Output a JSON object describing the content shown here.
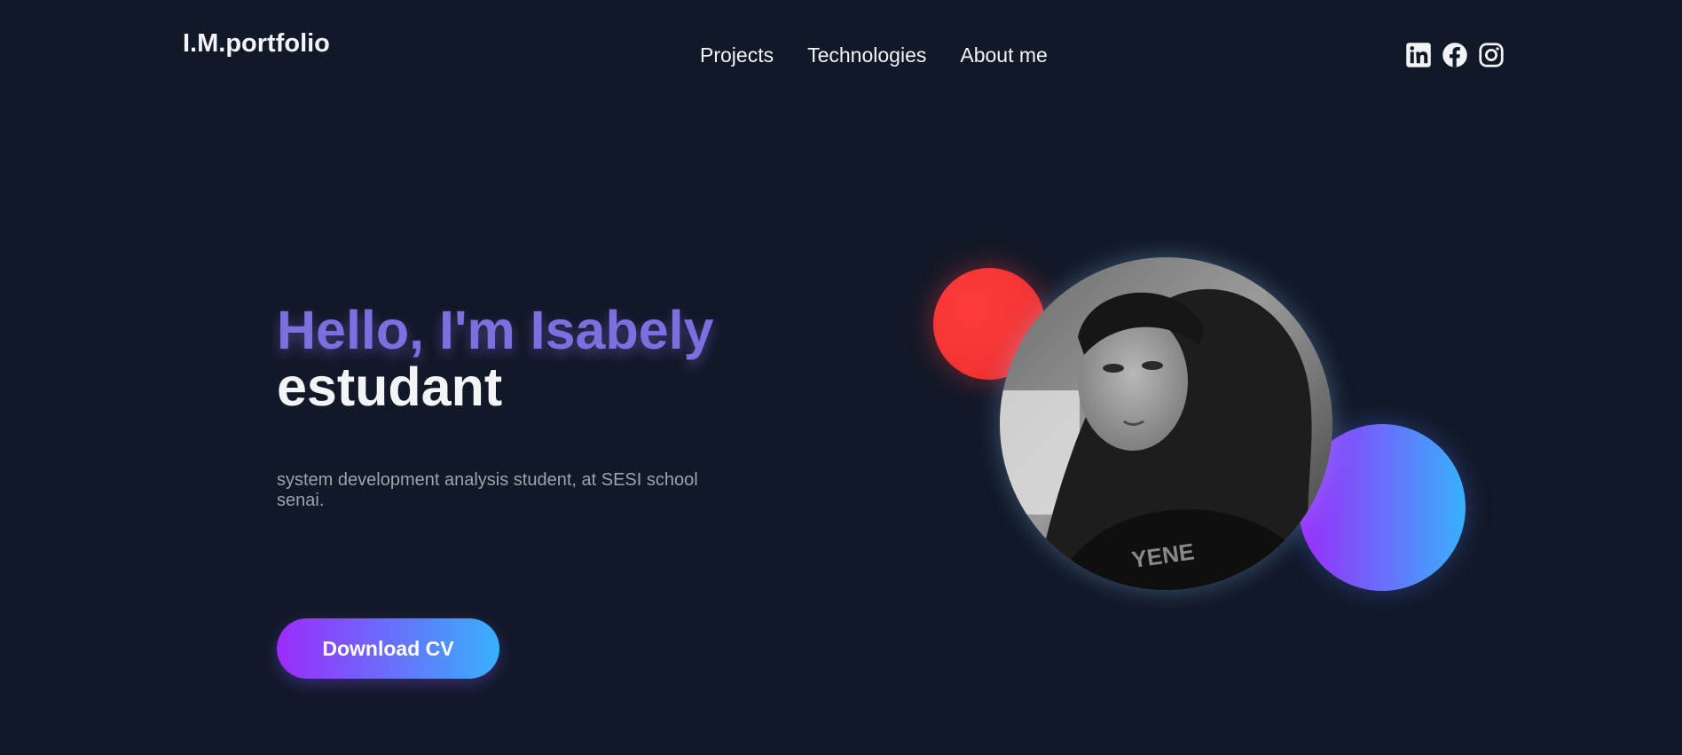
{
  "header": {
    "logo": "I.M.portfolio",
    "nav": [
      {
        "label": "Projects"
      },
      {
        "label": "Technologies"
      },
      {
        "label": "About me"
      }
    ],
    "socials": [
      "linkedin-icon",
      "facebook-icon",
      "instagram-icon"
    ]
  },
  "hero": {
    "greeting": "Hello, I'm Isabely",
    "role": "estudant",
    "description": "system development analysis student, at SESI school senai.",
    "cv_button": "Download CV",
    "photo_alt": "Profile photo"
  },
  "colors": {
    "background": "#111827",
    "accent_purple": "#7c6fe0",
    "gradient_start": "#9b2cfa",
    "gradient_end": "#38b0fd",
    "red_circle": "#f43434",
    "muted_text": "#9ca3af"
  }
}
